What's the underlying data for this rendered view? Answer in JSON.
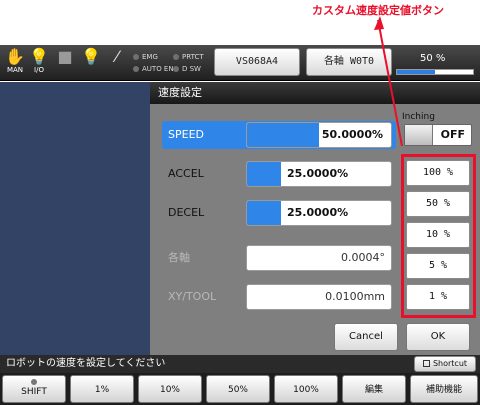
{
  "annotation": {
    "label": "カスタム速度設定値ボタン",
    "color": "#e8102a"
  },
  "topbar": {
    "icons": [
      {
        "name": "hand-icon",
        "caption": "MAN"
      },
      {
        "name": "lightbulb-icon",
        "caption": "I/O"
      },
      {
        "name": "stop-square-icon",
        "caption": ""
      },
      {
        "name": "lightbulb-icon-2",
        "caption": ""
      },
      {
        "name": "wrench-icon",
        "caption": ""
      }
    ],
    "lamps": [
      "EMG",
      "AUTO EN",
      "PRTCT",
      "D SW"
    ],
    "program_button": "VS068A4",
    "axis_button": "各軸 W0T0",
    "speed_label": "50 %",
    "speed_fraction": 0.5
  },
  "dialog": {
    "title": "速度設定",
    "inching_label": "Inching",
    "inching_value": "OFF",
    "rows": [
      {
        "label": "SPEED",
        "value": "50.0000%",
        "fill_fraction": 0.5,
        "selected": true
      },
      {
        "label": "ACCEL",
        "value": "25.0000%",
        "fill_fraction": 0.25,
        "selected": false
      },
      {
        "label": "DECEL",
        "value": "25.0000%",
        "fill_fraction": 0.25,
        "selected": false
      },
      {
        "label": "各軸",
        "value": "0.0004°",
        "readonly": true
      },
      {
        "label": "XY/TOOL",
        "value": "0.0100mm",
        "readonly": true
      }
    ],
    "preset_buttons": [
      "100 %",
      "50 %",
      "10 %",
      "5 %",
      "1 %"
    ],
    "cancel_label": "Cancel",
    "ok_label": "OK"
  },
  "message": "ロボットの速度を設定してください",
  "shortcut_label": "Shortcut",
  "softkeys": [
    "SHIFT",
    "1%",
    "10%",
    "50%",
    "100%",
    "編集",
    "補助機能"
  ]
}
